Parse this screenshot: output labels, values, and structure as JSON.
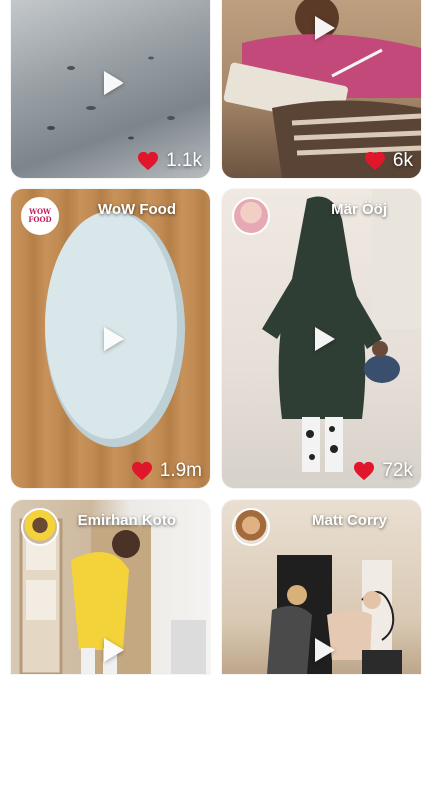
{
  "grid": {
    "cards": [
      {
        "likes": "1.1k"
      },
      {
        "likes": "6k"
      },
      {
        "author": "WoW Food",
        "likes": "1.9m",
        "avatar_text": "WOW FOOD"
      },
      {
        "author": "Mär Ööj",
        "likes": "72k"
      },
      {
        "author": "Emirhan Koto"
      },
      {
        "author": "Matt Corry"
      }
    ]
  },
  "icons": {
    "play": "play-icon",
    "like": "heart-icon"
  },
  "colors": {
    "heart": "#e0162b",
    "background": "#ffffff"
  }
}
